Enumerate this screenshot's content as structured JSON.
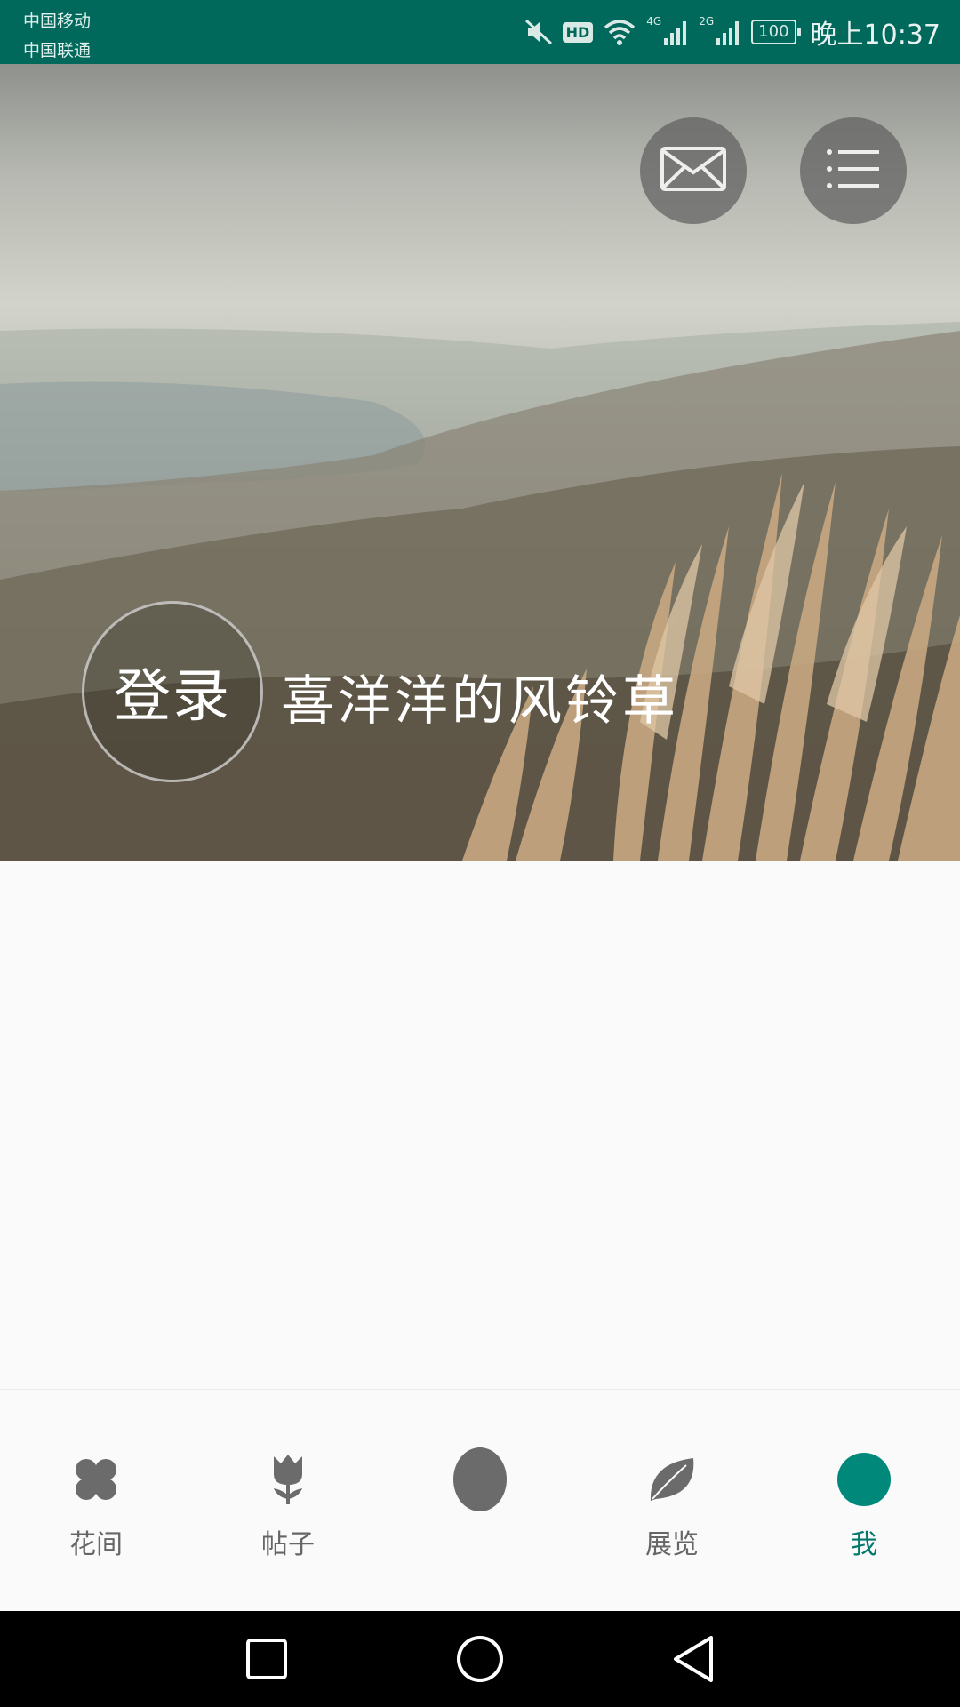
{
  "status_bar": {
    "carrier_1": "中国移动",
    "carrier_2": "中国联通",
    "hd_label": "HD",
    "network_1": "4G",
    "network_2": "2G",
    "battery": "100",
    "time": "晚上10:37"
  },
  "profile_header": {
    "login_label": "登录",
    "username": "喜洋洋的风铃草",
    "icons": {
      "mail": "mail-icon",
      "menu": "menu-icon"
    }
  },
  "bottom_nav": {
    "items": [
      {
        "label": "花间",
        "icon": "clover-icon",
        "active": false
      },
      {
        "label": "帖子",
        "icon": "tulip-icon",
        "active": false
      },
      {
        "label": "",
        "icon": "center-circle-icon",
        "active": false
      },
      {
        "label": "展览",
        "icon": "leaf-icon",
        "active": false
      },
      {
        "label": "我",
        "icon": "me-icon",
        "active": true
      }
    ]
  },
  "colors": {
    "status_bar": "#00695c",
    "accent": "#00897b",
    "inactive": "#6b6b6b",
    "background": "#fafafa"
  }
}
